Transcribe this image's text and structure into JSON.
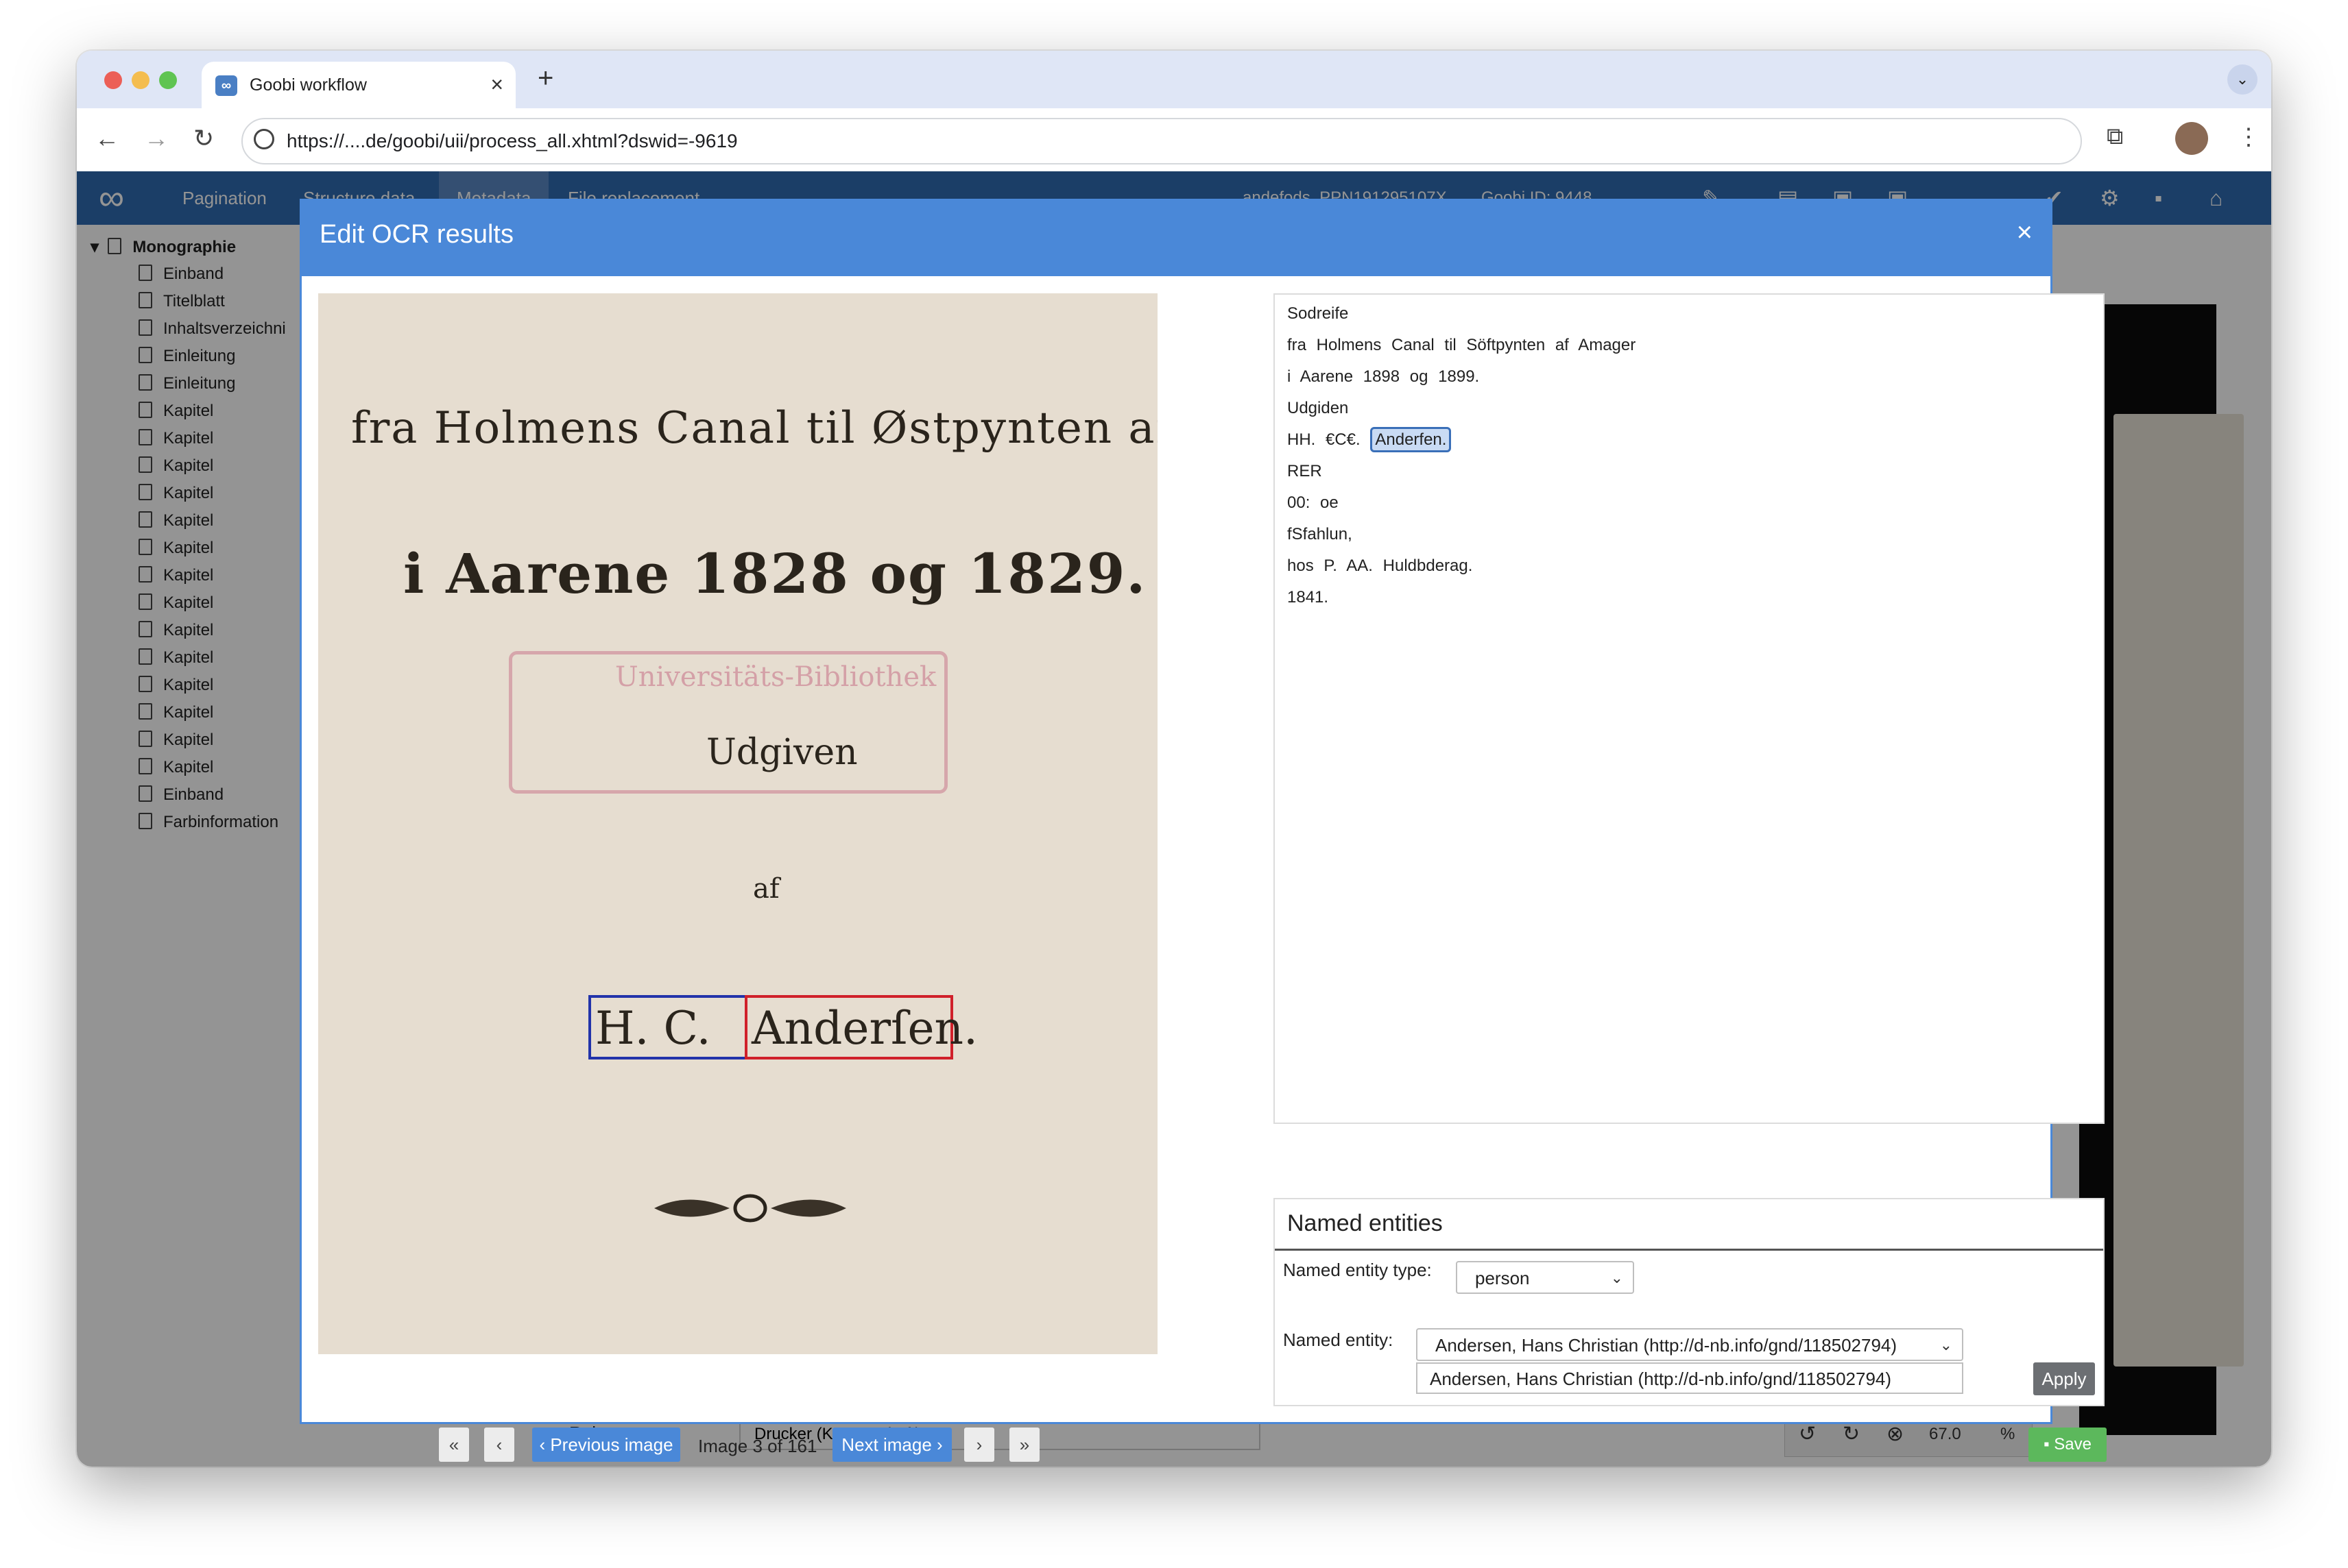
{
  "browser": {
    "tab_title": "Goobi workflow",
    "url": "https://....de/goobi/uii/process_all.xhtml?dswid=-9619"
  },
  "app": {
    "tabs": [
      "Pagination",
      "Structure data",
      "Metadata",
      "File replacement"
    ],
    "header_info": [
      "andefods_PPN191295107X",
      "Goobi ID: 9448"
    ],
    "zoom": "67.0",
    "zoom_unit": "%",
    "role_label": "Role:",
    "role_value": "Drucker (Körperschaft)"
  },
  "tree": {
    "root": "Monographie",
    "items": [
      "Einband",
      "Titelblatt",
      "Inhaltsverzeichni",
      "Einleitung",
      "Einleitung",
      "Kapitel",
      "Kapitel",
      "Kapitel",
      "Kapitel",
      "Kapitel",
      "Kapitel",
      "Kapitel",
      "Kapitel",
      "Kapitel",
      "Kapitel",
      "Kapitel",
      "Kapitel",
      "Kapitel",
      "Kapitel",
      "Einband",
      "Farbinformation"
    ]
  },
  "modal": {
    "title": "Edit OCR results",
    "close": "×",
    "scan_text": {
      "line1": "fra Holmens Canal til Østpynten af Amag",
      "line2": "i Aarene 1828 og 1829.",
      "stamp": "Universitäts-Bibliothek",
      "line3": "Udgiven",
      "line4": "af",
      "name_part1": "H. C.",
      "name_part2": "Anderſen."
    },
    "ocr_lines": [
      "Sodreife",
      "fra Holmens Canal til Söftpynten af Amager",
      "i Aarene 1898 og 1899.",
      "Udgiden",
      "HH. €C€.",
      "RER",
      "00: oe",
      "fSfahlun,",
      "hos P. AA. Huldbderag.",
      "1841."
    ],
    "ocr_highlight": "Anderfen.",
    "named_entities": {
      "title": "Named entities",
      "type_label": "Named entity type:",
      "type_value": "person",
      "entity_label": "Named entity:",
      "entity_value": "Andersen, Hans Christian (http://d-nb.info/gnd/118502794)",
      "entity_text": "Andersen, Hans Christian (http://d-nb.info/gnd/118502794)",
      "apply": "Apply"
    },
    "pager": {
      "first": "«",
      "prev": "‹",
      "prev_image": "‹ Previous image",
      "status": "Image 3 of 161",
      "next_image": "Next image ›",
      "next": "›",
      "last": "»"
    },
    "save": "Save"
  },
  "colors": {
    "header_blue": "#2f6bb2",
    "modal_blue": "#4a88d8",
    "save_green": "#5cb85c",
    "highlight_red": "#d0202a",
    "highlight_blue": "#2233aa"
  }
}
